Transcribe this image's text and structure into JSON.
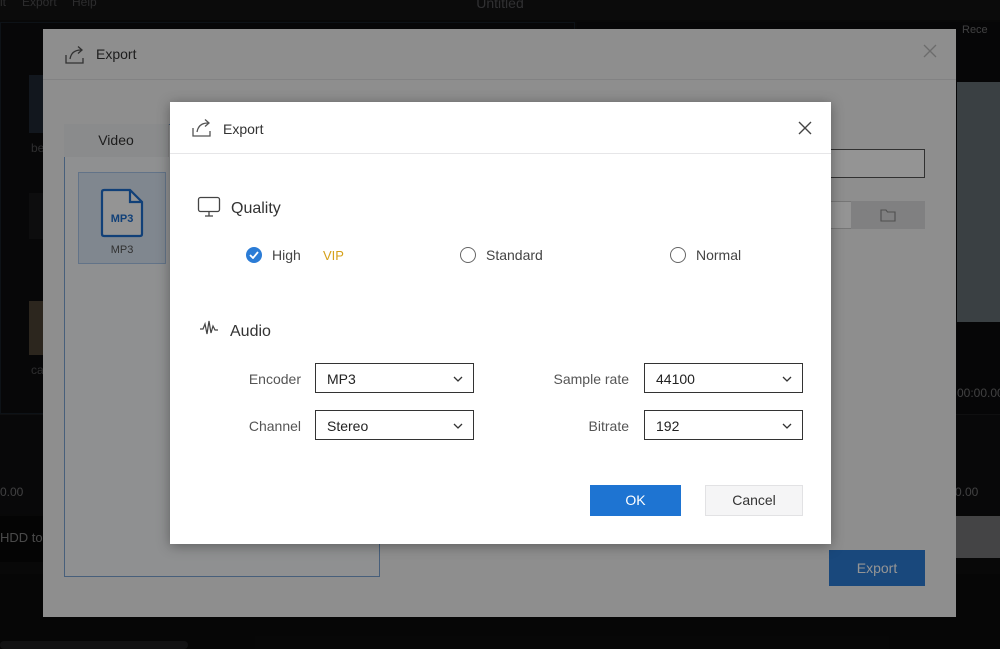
{
  "app": {
    "menu": [
      "it",
      "Export",
      "Help"
    ],
    "title": "Untitled",
    "preview_record_label": "Rece",
    "clip_label": "HDD to",
    "side_labels": [
      "be",
      "ca"
    ],
    "time_left": "0.00",
    "time_right": "0.00",
    "time_preview": "00:00.00"
  },
  "outer_dialog": {
    "title": "Export",
    "tab_video": "Video",
    "format_label": "MP3",
    "format_icon_text": "MP3",
    "export_button": "Export"
  },
  "dialog": {
    "title": "Export",
    "quality": {
      "title": "Quality",
      "options": [
        {
          "label": "High",
          "checked": true,
          "badge": "VIP"
        },
        {
          "label": "Standard",
          "checked": false
        },
        {
          "label": "Normal",
          "checked": false
        }
      ]
    },
    "audio": {
      "title": "Audio",
      "encoder": {
        "label": "Encoder",
        "value": "MP3"
      },
      "channel": {
        "label": "Channel",
        "value": "Stereo"
      },
      "sample_rate": {
        "label": "Sample rate",
        "value": "44100"
      },
      "bitrate": {
        "label": "Bitrate",
        "value": "192"
      }
    },
    "ok_button": "OK",
    "cancel_button": "Cancel"
  },
  "colors": {
    "accent": "#1e74d2",
    "vip": "#d5a11a"
  }
}
